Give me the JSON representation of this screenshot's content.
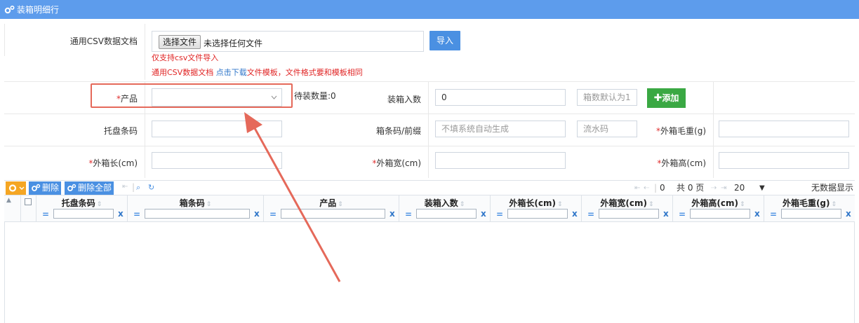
{
  "window": {
    "title": "装箱明细行"
  },
  "import_section": {
    "label": "通用CSV数据文档",
    "file_button": "选择文件",
    "file_status": "未选择任何文件",
    "import_button": "导入",
    "note_only_csv": "仅支持csv文件导入",
    "note_template_prefix": "通用CSV数据文档",
    "note_template_link": "点击下载",
    "note_template_suffix": "文件模板，文件格式要和模板相同"
  },
  "form": {
    "product_label": "产品",
    "pending_qty_label": "待装数量:0",
    "pack_qty_label": "装箱入数",
    "pack_qty_value": "0",
    "box_count_placeholder": "箱数默认为1",
    "add_button": "添加",
    "pallet_barcode_label": "托盘条码",
    "box_barcode_label": "箱条码/前缀",
    "box_barcode_placeholder": "不填系统自动生成",
    "serial_placeholder": "流水码",
    "gross_weight_label": "外箱毛重(g)",
    "length_label": "外箱长(cm)",
    "width_label": "外箱宽(cm)",
    "height_label": "外箱高(cm)",
    "required_mark": "*"
  },
  "grid": {
    "toolbar": {
      "delete": "删除",
      "delete_all": "删除全部"
    },
    "pager": {
      "page_value": "0",
      "total_pages": "共 0 页",
      "page_size": "20",
      "page_size_arrow": "▼",
      "no_data": "无数据显示"
    },
    "columns": [
      "托盘条码",
      "箱条码",
      "产品",
      "装箱入数",
      "外箱长(cm)",
      "外箱宽(cm)",
      "外箱高(cm)",
      "外箱毛重(g)"
    ],
    "filter_eq": "=",
    "filter_clear": "x"
  },
  "colors": {
    "titlebar": "#5d9cec",
    "primary_button": "#4a90e2",
    "add_button": "#3aa843",
    "required": "#e03030",
    "annotation": "#e5695a"
  },
  "icons": [
    "gears-icon",
    "plus-icon",
    "chevron-down-icon",
    "first-page-icon",
    "prev-page-icon",
    "next-page-icon",
    "last-page-icon",
    "search-icon",
    "refresh-icon",
    "collapse-icon",
    "sort-icon",
    "checkbox-icon"
  ]
}
